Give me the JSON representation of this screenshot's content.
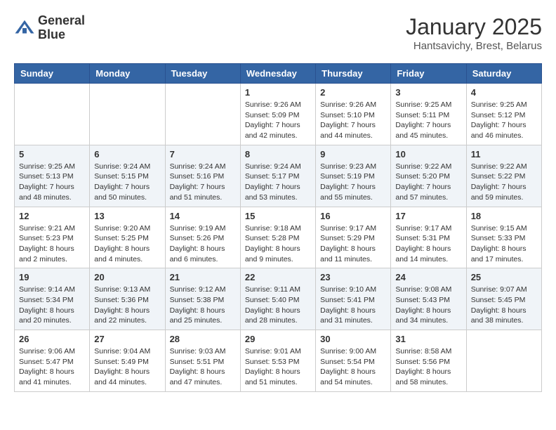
{
  "header": {
    "logo_line1": "General",
    "logo_line2": "Blue",
    "month_title": "January 2025",
    "subtitle": "Hantsavichy, Brest, Belarus"
  },
  "days_of_week": [
    "Sunday",
    "Monday",
    "Tuesday",
    "Wednesday",
    "Thursday",
    "Friday",
    "Saturday"
  ],
  "weeks": [
    [
      {
        "day": "",
        "info": ""
      },
      {
        "day": "",
        "info": ""
      },
      {
        "day": "",
        "info": ""
      },
      {
        "day": "1",
        "info": "Sunrise: 9:26 AM\nSunset: 5:09 PM\nDaylight: 7 hours\nand 42 minutes."
      },
      {
        "day": "2",
        "info": "Sunrise: 9:26 AM\nSunset: 5:10 PM\nDaylight: 7 hours\nand 44 minutes."
      },
      {
        "day": "3",
        "info": "Sunrise: 9:25 AM\nSunset: 5:11 PM\nDaylight: 7 hours\nand 45 minutes."
      },
      {
        "day": "4",
        "info": "Sunrise: 9:25 AM\nSunset: 5:12 PM\nDaylight: 7 hours\nand 46 minutes."
      }
    ],
    [
      {
        "day": "5",
        "info": "Sunrise: 9:25 AM\nSunset: 5:13 PM\nDaylight: 7 hours\nand 48 minutes."
      },
      {
        "day": "6",
        "info": "Sunrise: 9:24 AM\nSunset: 5:15 PM\nDaylight: 7 hours\nand 50 minutes."
      },
      {
        "day": "7",
        "info": "Sunrise: 9:24 AM\nSunset: 5:16 PM\nDaylight: 7 hours\nand 51 minutes."
      },
      {
        "day": "8",
        "info": "Sunrise: 9:24 AM\nSunset: 5:17 PM\nDaylight: 7 hours\nand 53 minutes."
      },
      {
        "day": "9",
        "info": "Sunrise: 9:23 AM\nSunset: 5:19 PM\nDaylight: 7 hours\nand 55 minutes."
      },
      {
        "day": "10",
        "info": "Sunrise: 9:22 AM\nSunset: 5:20 PM\nDaylight: 7 hours\nand 57 minutes."
      },
      {
        "day": "11",
        "info": "Sunrise: 9:22 AM\nSunset: 5:22 PM\nDaylight: 7 hours\nand 59 minutes."
      }
    ],
    [
      {
        "day": "12",
        "info": "Sunrise: 9:21 AM\nSunset: 5:23 PM\nDaylight: 8 hours\nand 2 minutes."
      },
      {
        "day": "13",
        "info": "Sunrise: 9:20 AM\nSunset: 5:25 PM\nDaylight: 8 hours\nand 4 minutes."
      },
      {
        "day": "14",
        "info": "Sunrise: 9:19 AM\nSunset: 5:26 PM\nDaylight: 8 hours\nand 6 minutes."
      },
      {
        "day": "15",
        "info": "Sunrise: 9:18 AM\nSunset: 5:28 PM\nDaylight: 8 hours\nand 9 minutes."
      },
      {
        "day": "16",
        "info": "Sunrise: 9:17 AM\nSunset: 5:29 PM\nDaylight: 8 hours\nand 11 minutes."
      },
      {
        "day": "17",
        "info": "Sunrise: 9:17 AM\nSunset: 5:31 PM\nDaylight: 8 hours\nand 14 minutes."
      },
      {
        "day": "18",
        "info": "Sunrise: 9:15 AM\nSunset: 5:33 PM\nDaylight: 8 hours\nand 17 minutes."
      }
    ],
    [
      {
        "day": "19",
        "info": "Sunrise: 9:14 AM\nSunset: 5:34 PM\nDaylight: 8 hours\nand 20 minutes."
      },
      {
        "day": "20",
        "info": "Sunrise: 9:13 AM\nSunset: 5:36 PM\nDaylight: 8 hours\nand 22 minutes."
      },
      {
        "day": "21",
        "info": "Sunrise: 9:12 AM\nSunset: 5:38 PM\nDaylight: 8 hours\nand 25 minutes."
      },
      {
        "day": "22",
        "info": "Sunrise: 9:11 AM\nSunset: 5:40 PM\nDaylight: 8 hours\nand 28 minutes."
      },
      {
        "day": "23",
        "info": "Sunrise: 9:10 AM\nSunset: 5:41 PM\nDaylight: 8 hours\nand 31 minutes."
      },
      {
        "day": "24",
        "info": "Sunrise: 9:08 AM\nSunset: 5:43 PM\nDaylight: 8 hours\nand 34 minutes."
      },
      {
        "day": "25",
        "info": "Sunrise: 9:07 AM\nSunset: 5:45 PM\nDaylight: 8 hours\nand 38 minutes."
      }
    ],
    [
      {
        "day": "26",
        "info": "Sunrise: 9:06 AM\nSunset: 5:47 PM\nDaylight: 8 hours\nand 41 minutes."
      },
      {
        "day": "27",
        "info": "Sunrise: 9:04 AM\nSunset: 5:49 PM\nDaylight: 8 hours\nand 44 minutes."
      },
      {
        "day": "28",
        "info": "Sunrise: 9:03 AM\nSunset: 5:51 PM\nDaylight: 8 hours\nand 47 minutes."
      },
      {
        "day": "29",
        "info": "Sunrise: 9:01 AM\nSunset: 5:53 PM\nDaylight: 8 hours\nand 51 minutes."
      },
      {
        "day": "30",
        "info": "Sunrise: 9:00 AM\nSunset: 5:54 PM\nDaylight: 8 hours\nand 54 minutes."
      },
      {
        "day": "31",
        "info": "Sunrise: 8:58 AM\nSunset: 5:56 PM\nDaylight: 8 hours\nand 58 minutes."
      },
      {
        "day": "",
        "info": ""
      }
    ]
  ]
}
